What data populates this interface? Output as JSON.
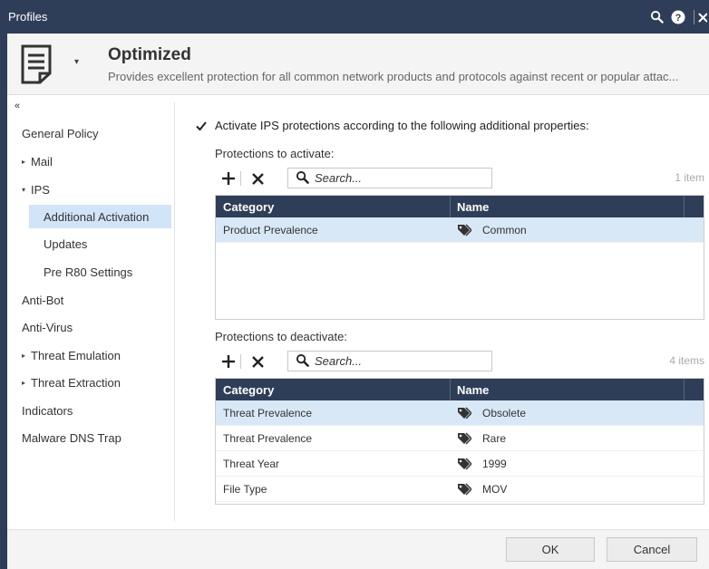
{
  "window": {
    "title": "Profiles"
  },
  "header": {
    "profile_name": "Optimized",
    "profile_description": "Provides excellent protection for all common network products and protocols against recent or popular attac..."
  },
  "sidebar": {
    "collapse_icon": "«",
    "items": [
      {
        "label": "General Policy",
        "arrow": ""
      },
      {
        "label": "Mail",
        "arrow": "▸"
      },
      {
        "label": "IPS",
        "arrow": "▾"
      },
      {
        "label": "Additional Activation",
        "arrow": ""
      },
      {
        "label": "Updates",
        "arrow": ""
      },
      {
        "label": "Pre R80 Settings",
        "arrow": ""
      },
      {
        "label": "Anti-Bot",
        "arrow": ""
      },
      {
        "label": "Anti-Virus",
        "arrow": ""
      },
      {
        "label": "Threat Emulation",
        "arrow": "▸"
      },
      {
        "label": "Threat Extraction",
        "arrow": "▸"
      },
      {
        "label": "Indicators",
        "arrow": ""
      },
      {
        "label": "Malware DNS Trap",
        "arrow": ""
      }
    ],
    "selected": "Additional Activation"
  },
  "main": {
    "activate_checkbox": {
      "label": "Activate IPS protections according to the following additional properties:",
      "checked": true
    },
    "activate_section": {
      "title": "Protections to activate:",
      "search_placeholder": "Search...",
      "count": "1 item",
      "columns": [
        "Category",
        "Name"
      ],
      "rows": [
        {
          "category": "Product Prevalence",
          "name": "Common"
        }
      ]
    },
    "deactivate_section": {
      "title": "Protections to deactivate:",
      "search_placeholder": "Search...",
      "count": "4 items",
      "columns": [
        "Category",
        "Name"
      ],
      "rows": [
        {
          "category": "Threat Prevalence",
          "name": "Obsolete"
        },
        {
          "category": "Threat Prevalence",
          "name": "Rare"
        },
        {
          "category": "Threat Year",
          "name": "1999"
        },
        {
          "category": "File Type",
          "name": "MOV"
        }
      ]
    }
  },
  "footer": {
    "ok_label": "OK",
    "cancel_label": "Cancel"
  },
  "colors": {
    "titlebar": "#2f3e58",
    "selected_row": "#d9e8f6",
    "selected_nav": "#d2e4f7"
  },
  "icons": {
    "titlebar": [
      "search-icon",
      "help-icon",
      "close-icon"
    ],
    "toolbar": [
      "add-icon",
      "remove-icon",
      "search-icon"
    ],
    "row": "tag-icon"
  }
}
